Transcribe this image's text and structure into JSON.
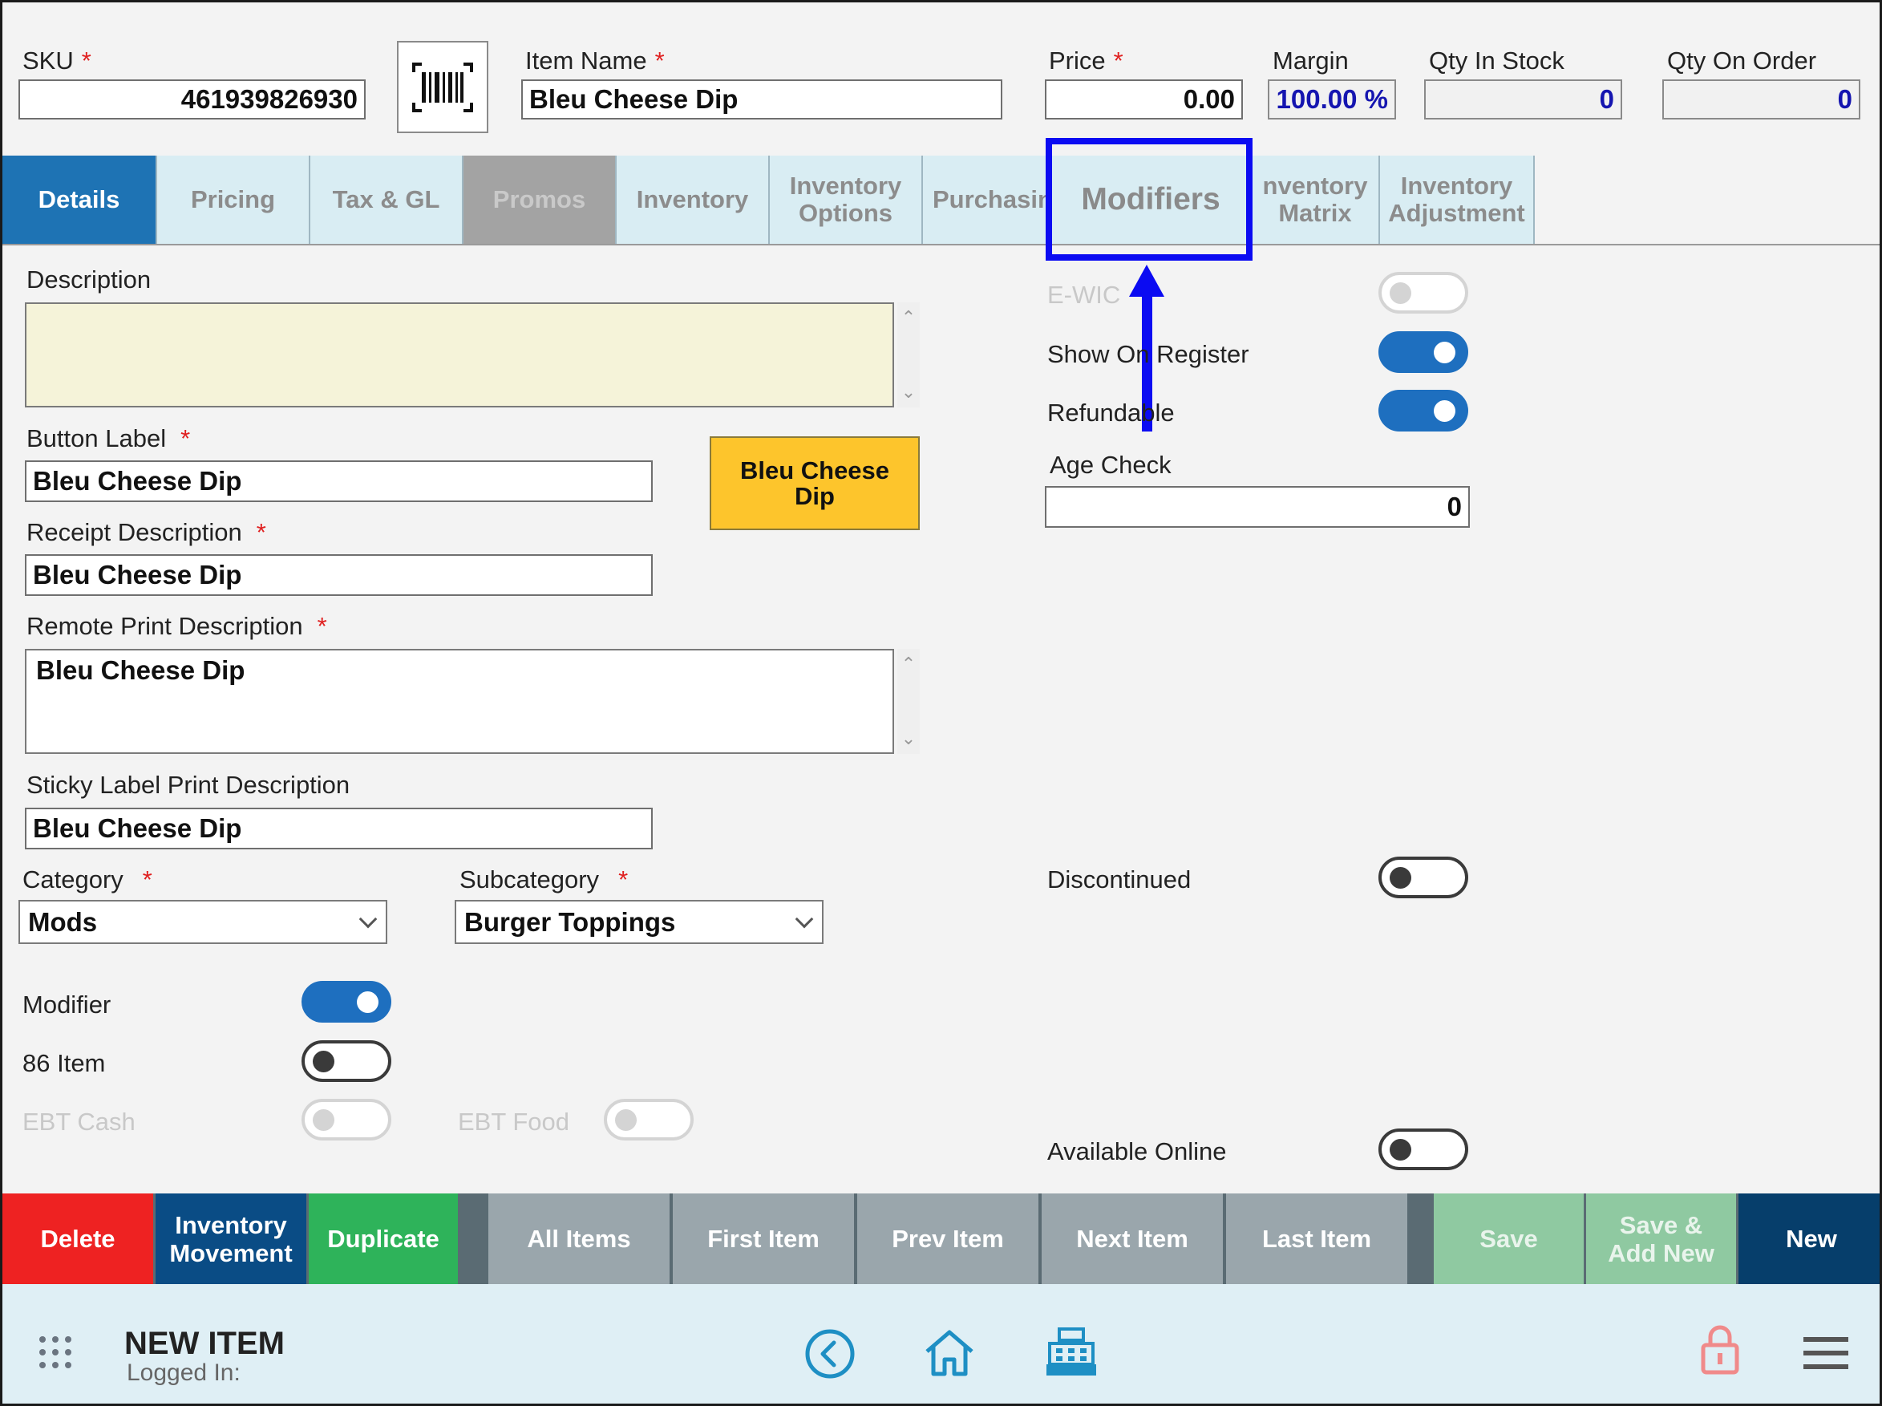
{
  "header": {
    "sku": {
      "label": "SKU",
      "value": "461939826930"
    },
    "item_name": {
      "label": "Item Name",
      "value": "Bleu Cheese Dip"
    },
    "price": {
      "label": "Price",
      "value": "0.00"
    },
    "margin": {
      "label": "Margin",
      "value": "100.00 %"
    },
    "qty_in_stock": {
      "label": "Qty In Stock",
      "value": "0"
    },
    "qty_on_order": {
      "label": "Qty On Order",
      "value": "0"
    }
  },
  "tabs": [
    {
      "label": "Details"
    },
    {
      "label": "Pricing"
    },
    {
      "label": "Tax & GL"
    },
    {
      "label": "Promos"
    },
    {
      "label": "Inventory"
    },
    {
      "label": "Inventory Options"
    },
    {
      "label": "Purchasin"
    },
    {
      "label": "Modifiers"
    },
    {
      "label": "nventory Matrix"
    },
    {
      "label": "Inventory Adjustment"
    }
  ],
  "details": {
    "description": {
      "label": "Description",
      "value": ""
    },
    "button_label": {
      "label": "Button Label",
      "value": "Bleu Cheese Dip"
    },
    "button_preview": {
      "text": "Bleu Cheese Dip",
      "color": "#fdc52c"
    },
    "receipt_description": {
      "label": "Receipt Description",
      "value": "Bleu Cheese Dip"
    },
    "remote_print_description": {
      "label": "Remote Print Description",
      "value": "Bleu Cheese Dip"
    },
    "sticky_label": {
      "label": "Sticky Label Print Description",
      "value": "Bleu Cheese Dip"
    },
    "category": {
      "label": "Category",
      "value": "Mods"
    },
    "subcategory": {
      "label": "Subcategory",
      "value": "Burger Toppings"
    },
    "modifier": {
      "label": "Modifier",
      "on": true
    },
    "item86": {
      "label": "86 Item",
      "on": false
    },
    "ebt_cash": {
      "label": "EBT Cash",
      "on": false
    },
    "ebt_food": {
      "label": "EBT Food",
      "on": false
    },
    "ewic": {
      "label": "E-WIC",
      "on": false
    },
    "show_on_register": {
      "label": "Show On Register",
      "on": true
    },
    "refundable": {
      "label": "Refundable",
      "on": true
    },
    "age_check": {
      "label": "Age Check",
      "value": "0"
    },
    "discontinued": {
      "label": "Discontinued",
      "on": false
    },
    "available_online": {
      "label": "Available Online",
      "on": false
    }
  },
  "actions": {
    "delete": "Delete",
    "inventory_movement": "Inventory Movement",
    "duplicate": "Duplicate",
    "all_items": "All Items",
    "first_item": "First Item",
    "prev_item": "Prev Item",
    "next_item": "Next Item",
    "last_item": "Last Item",
    "save": "Save",
    "save_add_new": "Save & Add New",
    "new": "New"
  },
  "footer": {
    "title": "NEW ITEM",
    "logged_in": "Logged In:"
  },
  "colors": {
    "accent": "#1e73b4",
    "annotation": "#0b0bf2",
    "delete": "#ee2222",
    "duplicate": "#2eb35a",
    "new": "#063e6b"
  },
  "icons": [
    "grid-menu-icon",
    "back-circle-icon",
    "home-icon",
    "register-icon",
    "lock-icon",
    "hamburger-menu-icon",
    "barcode-icon"
  ]
}
